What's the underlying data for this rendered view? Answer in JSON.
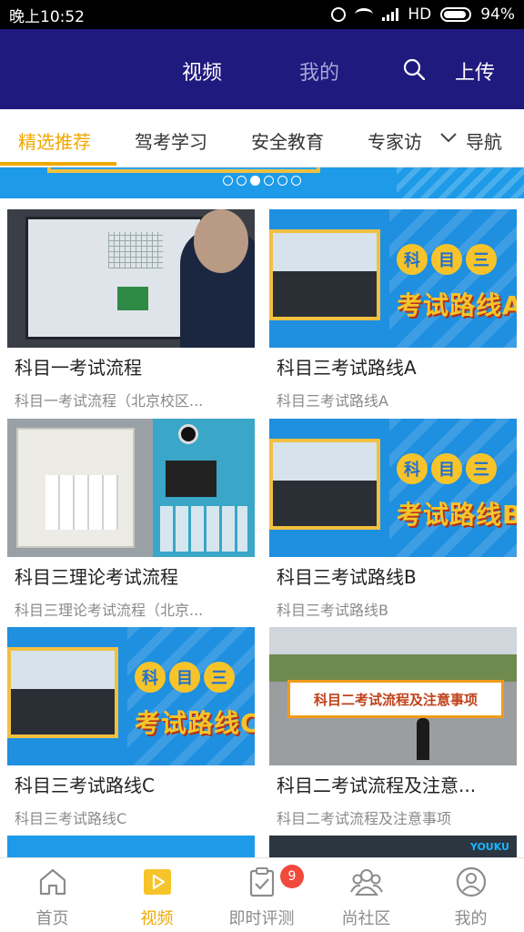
{
  "status_bar": {
    "time": "晚上10:52",
    "network": "HD",
    "battery": "94%"
  },
  "header": {
    "tab_video": "视频",
    "tab_mine": "我的",
    "search_icon": "search-icon",
    "upload_label": "上传"
  },
  "categories": {
    "items": [
      "精选推荐",
      "驾考学习",
      "安全教育",
      "专家访"
    ],
    "active": "精选推荐",
    "nav_label": "导航"
  },
  "videos": [
    {
      "title": "科目一考试流程",
      "subtitle": "科目一考试流程（北京校区..."
    },
    {
      "title": "科目三考试路线A",
      "subtitle": "科目三考试路线A",
      "thumb_badge": [
        "科",
        "目",
        "三"
      ],
      "thumb_text": "考试路线A"
    },
    {
      "title": "科目三理论考试流程",
      "subtitle": "科目三理论考试流程（北京..."
    },
    {
      "title": "科目三考试路线B",
      "subtitle": "科目三考试路线B",
      "thumb_badge": [
        "科",
        "目",
        "三"
      ],
      "thumb_text": "考试路线B"
    },
    {
      "title": "科目三考试路线C",
      "subtitle": "科目三考试路线C",
      "thumb_badge": [
        "科",
        "目",
        "三"
      ],
      "thumb_text": "考试路线C"
    },
    {
      "title": "科目二考试流程及注意...",
      "subtitle": "科目二考试流程及注意事项",
      "thumb_text": "科目二考试流程及注意事项"
    }
  ],
  "peek": {
    "right_logo": "YOUKU"
  },
  "bottom_nav": {
    "items": [
      "首页",
      "视频",
      "即时评测",
      "尚社区",
      "我的"
    ],
    "active": "视频",
    "badge_count": "9"
  },
  "colors": {
    "header_bg": "#1f1a7e",
    "accent": "#f0a800",
    "banner": "#1e9be8",
    "badge": "#f2493d"
  }
}
